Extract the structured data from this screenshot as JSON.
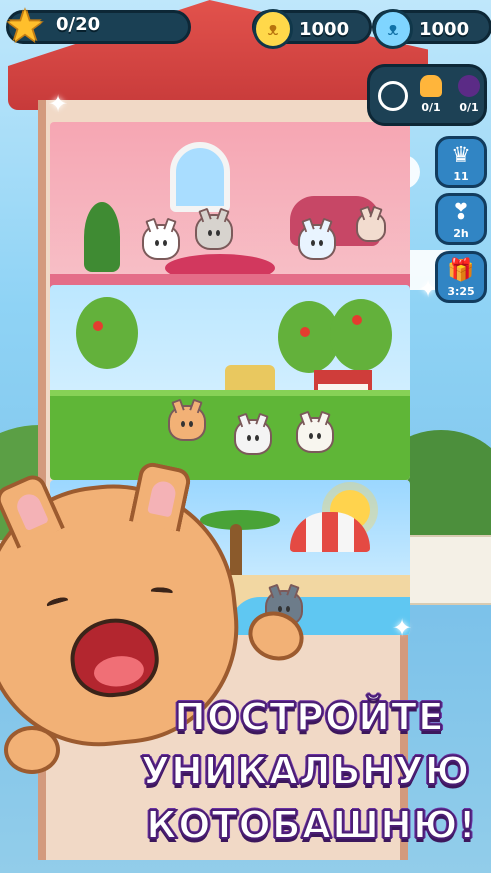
{
  "hud": {
    "xp_text": "0/20",
    "xp_fraction": 0,
    "coins": "1000",
    "gems": "1000",
    "quests": [
      {
        "icon": "empty-slot-icon",
        "count": ""
      },
      {
        "icon": "bell-icon",
        "count": "0/1"
      },
      {
        "icon": "bomb-icon",
        "count": "0/1"
      }
    ],
    "side_buttons": [
      {
        "name": "crown-button",
        "icon": "crown-icon",
        "label": "11"
      },
      {
        "name": "bow-button",
        "icon": "bow-icon",
        "label": "2h"
      },
      {
        "name": "gift-button",
        "icon": "gift-icon",
        "label": "3:25"
      }
    ]
  },
  "caption": {
    "line1": "ПОСТРОЙТЕ",
    "line2": "УНИКАЛЬНУЮ",
    "line3": "КОТОБАШНЮ!"
  }
}
